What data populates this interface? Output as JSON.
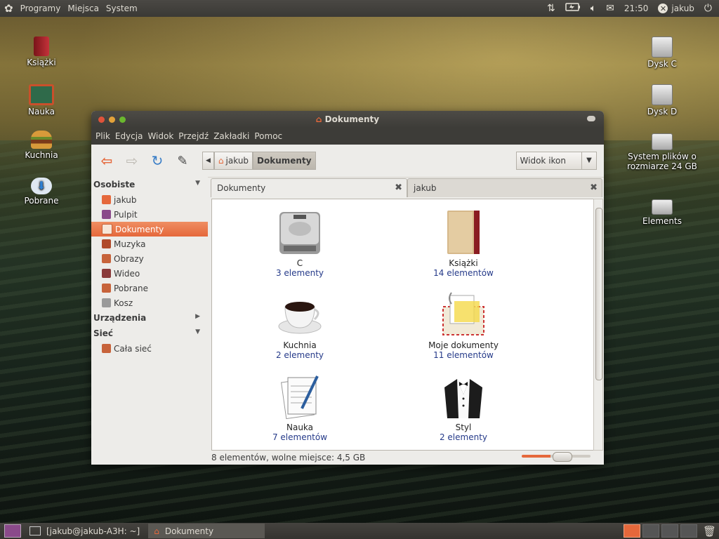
{
  "top_panel": {
    "menus": [
      "Programy",
      "Miejsca",
      "System"
    ],
    "clock": "21:50",
    "user": "jakub",
    "tray_icons": [
      "network-icon",
      "battery-icon",
      "volume-icon",
      "mail-icon",
      "close-session-icon",
      "power-icon"
    ]
  },
  "desktop_icons_left": [
    {
      "label": "Książki",
      "icon": "book-icon",
      "color": "#b3242b"
    },
    {
      "label": "Nauka",
      "icon": "chalkboard-icon",
      "color": "#c9502b"
    },
    {
      "label": "Kuchnia",
      "icon": "burger-icon",
      "color": "#d6902c"
    },
    {
      "label": "Pobrane",
      "icon": "download-cloud-icon",
      "color": "#4a8fd1"
    }
  ],
  "desktop_icons_right": [
    {
      "label": "Dysk C",
      "icon": "harddisk-icon"
    },
    {
      "label": "Dysk D",
      "icon": "harddisk-icon"
    },
    {
      "label": "System plików o rozmiarze 24 GB",
      "icon": "harddisk-icon"
    },
    {
      "label": "Elements",
      "icon": "usb-drive-icon"
    }
  ],
  "window": {
    "title": "Dokumenty",
    "menubar": [
      "Plik",
      "Edycja",
      "Widok",
      "Przejdź",
      "Zakładki",
      "Pomoc"
    ],
    "breadcrumb": [
      "jakub",
      "Dokumenty"
    ],
    "view_mode": "Widok ikon",
    "sidebar": {
      "sections": [
        {
          "title": "Osobiste",
          "expanded": true,
          "items": [
            {
              "label": "jakub",
              "icon": "home-icon",
              "color": "#e5683b"
            },
            {
              "label": "Pulpit",
              "icon": "desktop-icon",
              "color": "#8a4a8a"
            },
            {
              "label": "Dokumenty",
              "icon": "documents-icon",
              "color": "#c7633a",
              "selected": true
            },
            {
              "label": "Muzyka",
              "icon": "music-icon",
              "color": "#b04a2a"
            },
            {
              "label": "Obrazy",
              "icon": "pictures-icon",
              "color": "#c7633a"
            },
            {
              "label": "Wideo",
              "icon": "video-icon",
              "color": "#8a3a3a"
            },
            {
              "label": "Pobrane",
              "icon": "downloads-icon",
              "color": "#c7633a"
            },
            {
              "label": "Kosz",
              "icon": "trash-icon",
              "color": "#8a8a8a"
            }
          ]
        },
        {
          "title": "Urządzenia",
          "expanded": false,
          "items": []
        },
        {
          "title": "Sieć",
          "expanded": true,
          "items": [
            {
              "label": "Cała sieć",
              "icon": "network-icon",
              "color": "#c7633a"
            }
          ]
        }
      ]
    },
    "tabs": [
      {
        "label": "Dokumenty",
        "active": true
      },
      {
        "label": "jakub",
        "active": false
      }
    ],
    "items": [
      {
        "name": "C",
        "count": "3 elementy",
        "icon": "harddisk-icon"
      },
      {
        "name": "Książki",
        "count": "14 elementów",
        "icon": "book-icon"
      },
      {
        "name": "Kuchnia",
        "count": "2 elementy",
        "icon": "coffee-cup-icon"
      },
      {
        "name": "Moje dokumenty",
        "count": "11 elementów",
        "icon": "mail-documents-icon"
      },
      {
        "name": "Nauka",
        "count": "7 elementów",
        "icon": "notepad-pencil-icon"
      },
      {
        "name": "Styl",
        "count": "2 elementy",
        "icon": "tuxedo-icon"
      }
    ],
    "status": "8 elementów, wolne miejsce: 4,5 GB",
    "zoom_level": 0.42
  },
  "bottom_panel": {
    "tasks": [
      {
        "label": "[jakub@jakub-A3H: ~]",
        "icon": "terminal-icon"
      },
      {
        "label": "Dokumenty",
        "icon": "folder-home-icon",
        "active": true
      }
    ]
  }
}
